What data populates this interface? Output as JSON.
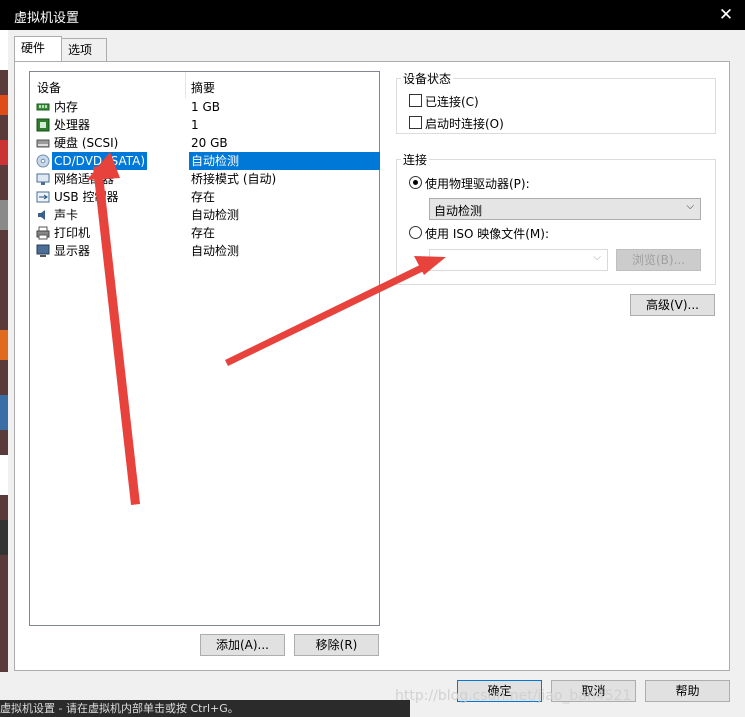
{
  "window": {
    "title": "虚拟机设置",
    "close_glyph": "✕"
  },
  "tabs": [
    {
      "label": "硬件",
      "active": true
    },
    {
      "label": "选项",
      "active": false
    }
  ],
  "devices": {
    "col_device": "设备",
    "col_summary": "摘要",
    "items": [
      {
        "name": "内存",
        "summary": "1 GB",
        "icon": "memory-icon"
      },
      {
        "name": "处理器",
        "summary": "1",
        "icon": "cpu-icon"
      },
      {
        "name": "硬盘 (SCSI)",
        "summary": "20 GB",
        "icon": "harddisk-icon"
      },
      {
        "name": "CD/DVD (SATA)",
        "summary": "自动检测",
        "icon": "cd-dvd-icon",
        "selected": true
      },
      {
        "name": "网络适配器",
        "summary": "桥接模式 (自动)",
        "icon": "network-adapter-icon"
      },
      {
        "name": "USB 控制器",
        "summary": "存在",
        "icon": "usb-icon"
      },
      {
        "name": "声卡",
        "summary": "自动检测",
        "icon": "sound-card-icon"
      },
      {
        "name": "打印机",
        "summary": "存在",
        "icon": "printer-icon"
      },
      {
        "name": "显示器",
        "summary": "自动检测",
        "icon": "display-icon"
      }
    ],
    "add_button": "添加(A)...",
    "remove_button": "移除(R)"
  },
  "device_status": {
    "title": "设备状态",
    "connected_label": "已连接(C)",
    "connect_on_power_label": "启动时连接(O)"
  },
  "connection": {
    "title": "连接",
    "physical_drive_label": "使用物理驱动器(P):",
    "physical_drive_value": "自动检测",
    "iso_label": "使用 ISO 映像文件(M):",
    "iso_value": "",
    "browse_button": "浏览(B)...",
    "advanced_button": "高级(V)..."
  },
  "footer": {
    "ok_button": "确定",
    "cancel_button": "取消",
    "help_button": "帮助",
    "watermark": "http://blog.csdn.net/jiao_ban4521",
    "taskbar_text": "虚拟机设置 - 请在虚拟机内部单击或按 Ctrl+G。"
  },
  "colors": {
    "selection": "#0078d7",
    "annotation_arrow": "#e8423c"
  }
}
